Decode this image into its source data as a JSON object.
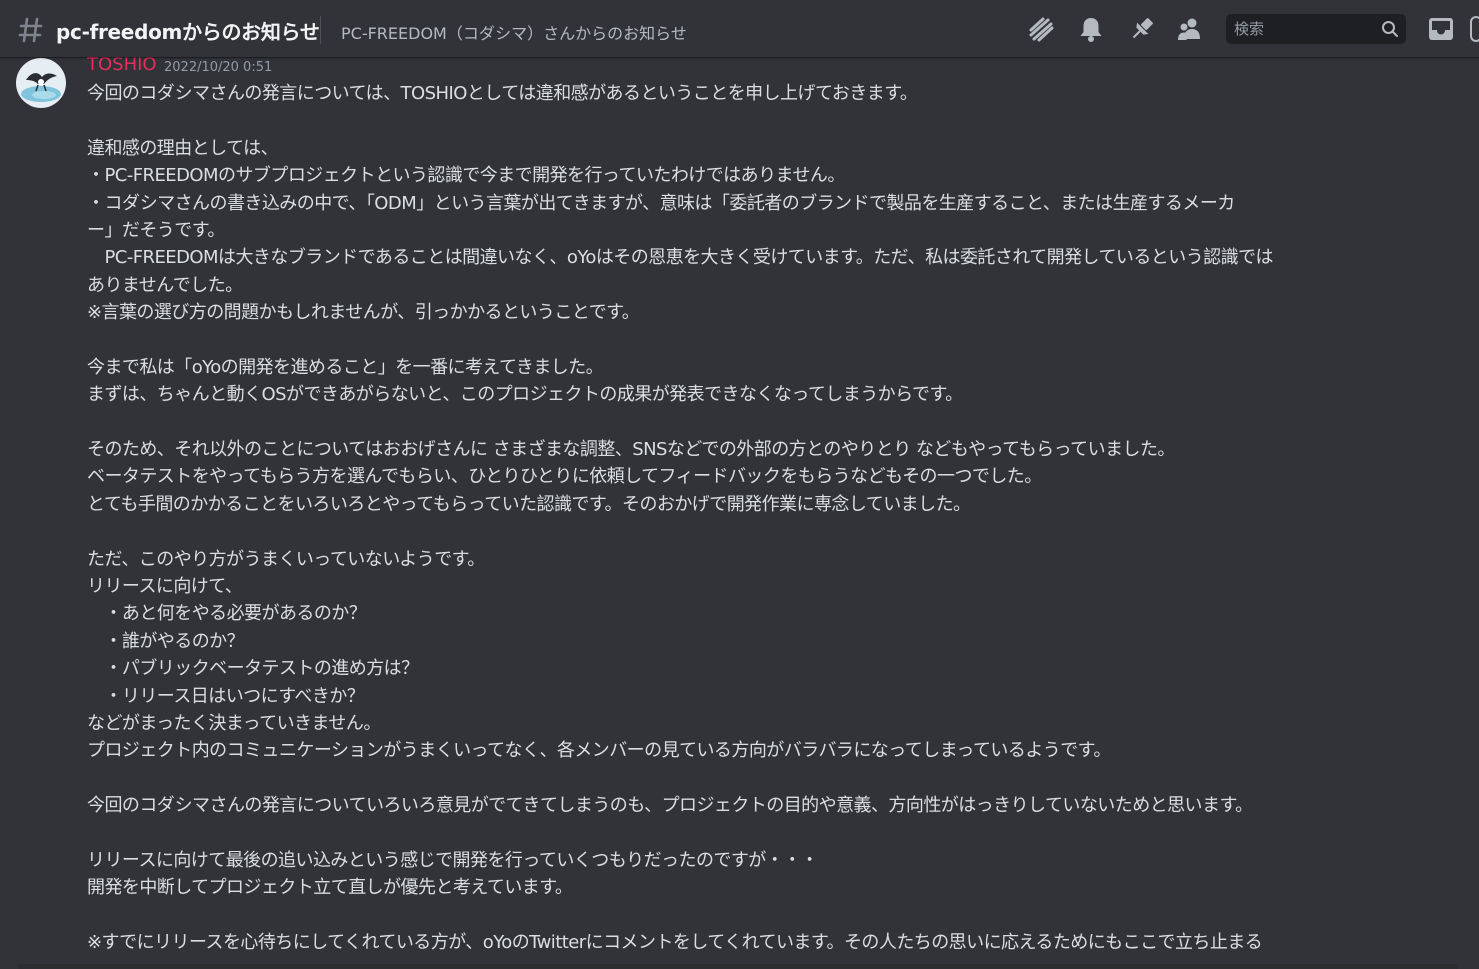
{
  "header": {
    "channel_name": "pc-freedomからのお知らせ",
    "topic": "PC-FREEDOM（コダシマ）さんからのお知らせ",
    "search_placeholder": "検索"
  },
  "icons": {
    "threads": "threads-icon",
    "notifications": "bell-icon",
    "pinned": "pin-icon",
    "members": "members-icon",
    "search": "search-icon",
    "inbox": "inbox-icon"
  },
  "colors": {
    "background": "#313338",
    "author": "#e62e5c",
    "text": "#dbdee1",
    "muted": "#949ba4"
  },
  "message": {
    "author": "TOSHIO",
    "timestamp": "2022/10/20 0:51",
    "lines": [
      "今回のコダシマさんの発言については、TOSHIOとしては違和感があるということを申し上げておきます。",
      "",
      "違和感の理由としては、",
      "・PC-FREEDOMのサブプロジェクトという認識で今まで開発を行っていたわけではありません。",
      "・コダシマさんの書き込みの中で、「ODM」という言葉が出てきますが、意味は「委託者のブランドで製品を生産すること、または生産するメーカ",
      "ー」だそうです。",
      "　PC-FREEDOMは大きなブランドであることは間違いなく、oYoはその恩恵を大きく受けています。ただ、私は委託されて開発しているという認識では",
      "ありませんでした。",
      "※言葉の選び方の問題かもしれませんが、引っかかるということです。",
      "",
      "今まで私は「oYoの開発を進めること」を一番に考えてきました。",
      "まずは、ちゃんと動くOSができあがらないと、このプロジェクトの成果が発表できなくなってしまうからです。",
      "",
      "そのため、それ以外のことについてはおおげさんに さまざまな調整、SNSなどでの外部の方とのやりとり などもやってもらっていました。",
      "ベータテストをやってもらう方を選んでもらい、ひとりひとりに依頼してフィードバックをもらうなどもその一つでした。",
      "とても手間のかかることをいろいろとやってもらっていた認識です。そのおかげで開発作業に専念していました。",
      "",
      "ただ、このやり方がうまくいっていないようです。",
      "リリースに向けて、",
      "　・あと何をやる必要があるのか？",
      "　・誰がやるのか？",
      "　・パブリックベータテストの進め方は？",
      "　・リリース日はいつにすべきか？",
      "などがまったく決まっていきません。",
      "プロジェクト内のコミュニケーションがうまくいってなく、各メンバーの見ている方向がバラバラになってしまっているようです。",
      "",
      "今回のコダシマさんの発言についていろいろ意見がでてきてしまうのも、プロジェクトの目的や意義、方向性がはっきりしていないためと思います。",
      "",
      "リリースに向けて最後の追い込みという感じで開発を行っていくつもりだったのですが・・・",
      "開発を中断してプロジェクト立て直しが優先と考えています。",
      "",
      "※すでにリリースを心待ちにしてくれている方が、oYoのTwitterにコメントをしてくれています。その人たちの思いに応えるためにもここで立ち止まる"
    ]
  }
}
